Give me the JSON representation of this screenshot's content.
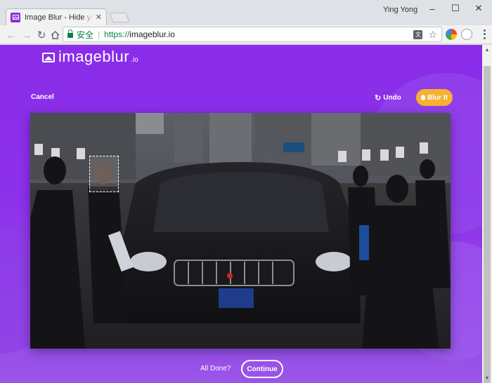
{
  "browser": {
    "tab_title": "Image Blur - Hide your objects",
    "user_name": "Ying Yong",
    "secure_label": "安全",
    "url_scheme": "https://",
    "url_host": "imageblur.io",
    "window_controls": {
      "minimize": "–",
      "maximize": "☐",
      "close": "✕"
    },
    "nav_icons": {
      "back": "arrow-left-icon",
      "forward": "arrow-right-icon",
      "reload": "reload-icon",
      "home": "home-icon"
    }
  },
  "app": {
    "logo_name": "imageblur",
    "logo_tld": ".io",
    "cancel_label": "Cancel",
    "undo_label": "Undo",
    "blur_label": "Blur It",
    "all_done_label": "All Done?",
    "continue_label": "Continue",
    "colors": {
      "purple": "#8a2ce9",
      "accent": "#f8b032"
    }
  }
}
